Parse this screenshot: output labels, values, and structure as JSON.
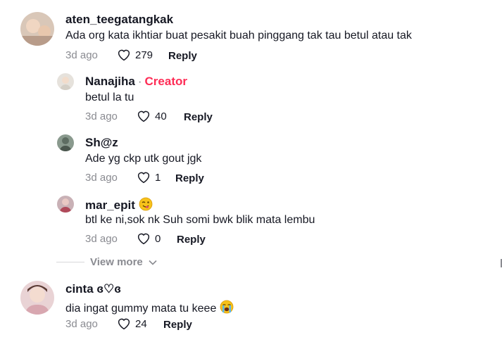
{
  "comments": [
    {
      "username": "aten_teegatangkak",
      "text": "Ada org kata ikhtiar buat pesakit buah pinggang tak tau betul atau tak",
      "time": "3d ago",
      "likes": "279",
      "reply": "Reply"
    },
    {
      "username": "Nanajiha",
      "creator_sep": "·",
      "creator": "Creator",
      "text": "betul la tu",
      "time": "3d ago",
      "likes": "40",
      "reply": "Reply"
    },
    {
      "username": "Sh@z",
      "text": "Ade yg ckp utk gout jgk",
      "time": "3d ago",
      "likes": "1",
      "reply": "Reply"
    },
    {
      "username": "mar_epit",
      "text": "btl ke ni,sok nk Suh somi bwk blik mata lembu",
      "time": "3d ago",
      "likes": "0",
      "reply": "Reply"
    },
    {
      "username": "cinta ɞ♡ɞ",
      "text": "dia ingat gummy mata tu keee",
      "time": "3d ago",
      "likes": "24",
      "reply": "Reply"
    }
  ],
  "view_more": "View more",
  "colors": {
    "creator": "#fe2c55",
    "muted": "#8a8b91",
    "text": "#161823"
  }
}
